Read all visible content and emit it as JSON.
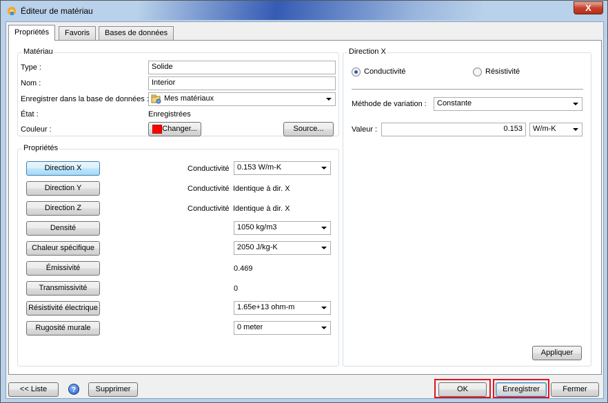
{
  "window": {
    "title": "Éditeur de matériau",
    "close_label": "X"
  },
  "tabs": [
    {
      "label": "Propriétés",
      "active": true
    },
    {
      "label": "Favoris",
      "active": false
    },
    {
      "label": "Bases de données",
      "active": false
    }
  ],
  "material": {
    "group_title": "Matériau",
    "type_label": "Type :",
    "type_value": "Solide",
    "name_label": "Nom :",
    "name_value": "Interior",
    "save_db_label": "Enregistrer dans la base de données :",
    "save_db_value": "Mes matériaux",
    "state_label": "État :",
    "state_value": "Enregistrées",
    "color_label": "Couleur :",
    "color_value": "#ff0000",
    "change_button": "Changer...",
    "source_button": "Source..."
  },
  "properties": {
    "group_title": "Propriétés",
    "rows": [
      {
        "button": "Direction X",
        "label": "Conductivité",
        "value": "0.153 W/m-K",
        "kind": "combo",
        "selected": true
      },
      {
        "button": "Direction Y",
        "label": "Conductivité",
        "value": "Identique à dir. X",
        "kind": "text"
      },
      {
        "button": "Direction Z",
        "label": "Conductivité",
        "value": "Identique à dir. X",
        "kind": "text"
      },
      {
        "button": "Densité",
        "label": "",
        "value": "1050 kg/m3",
        "kind": "combo"
      },
      {
        "button": "Chaleur spécifique",
        "label": "",
        "value": "2050 J/kg-K",
        "kind": "combo"
      },
      {
        "button": "Émissivité",
        "label": "",
        "value": "0.469",
        "kind": "text"
      },
      {
        "button": "Transmissivité",
        "label": "",
        "value": "0",
        "kind": "text"
      },
      {
        "button": "Résistivité électrique",
        "label": "",
        "value": "1.65e+13 ohm-m",
        "kind": "combo"
      },
      {
        "button": "Rugosité murale",
        "label": "",
        "value": "0 meter",
        "kind": "combo"
      }
    ]
  },
  "direction_x": {
    "group_title": "Direction X",
    "radio_conductivity": "Conductivité",
    "radio_resistivity": "Résistivité",
    "selected": "Conductivité",
    "variation_label": "Méthode de variation :",
    "variation_value": "Constante",
    "value_label": "Valeur :",
    "value": "0.153",
    "unit": "W/m-K",
    "apply_button": "Appliquer"
  },
  "footer": {
    "list_button": "<< Liste",
    "help_icon": "?",
    "delete_button": "Supprimer",
    "ok_button": "OK",
    "save_button": "Enregistrer",
    "close_button": "Fermer"
  },
  "colors": {
    "highlight_frame": "#e0141e",
    "swatch": "#ff0000"
  }
}
